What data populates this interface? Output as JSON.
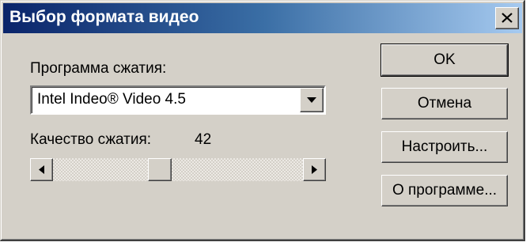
{
  "window": {
    "title": "Выбор формата видео",
    "close_glyph": "×"
  },
  "compression": {
    "program_label": "Программа сжатия:",
    "program_value": "Intel Indeo® Video 4.5",
    "quality_label": "Качество сжатия:",
    "quality_value": "42",
    "quality_min": 0,
    "quality_max": 100
  },
  "buttons": {
    "ok": "OK",
    "cancel": "Отмена",
    "configure": "Настроить...",
    "about": "О программе..."
  },
  "icons": {
    "close": "close-icon",
    "dropdown": "chevron-down-icon",
    "scroll_left": "scroll-left-arrow-icon",
    "scroll_right": "scroll-right-arrow-icon"
  },
  "colors": {
    "face": "#d4d0c8",
    "title_start": "#0a246a",
    "title_end": "#a6caf0",
    "title_text": "#ffffff"
  }
}
